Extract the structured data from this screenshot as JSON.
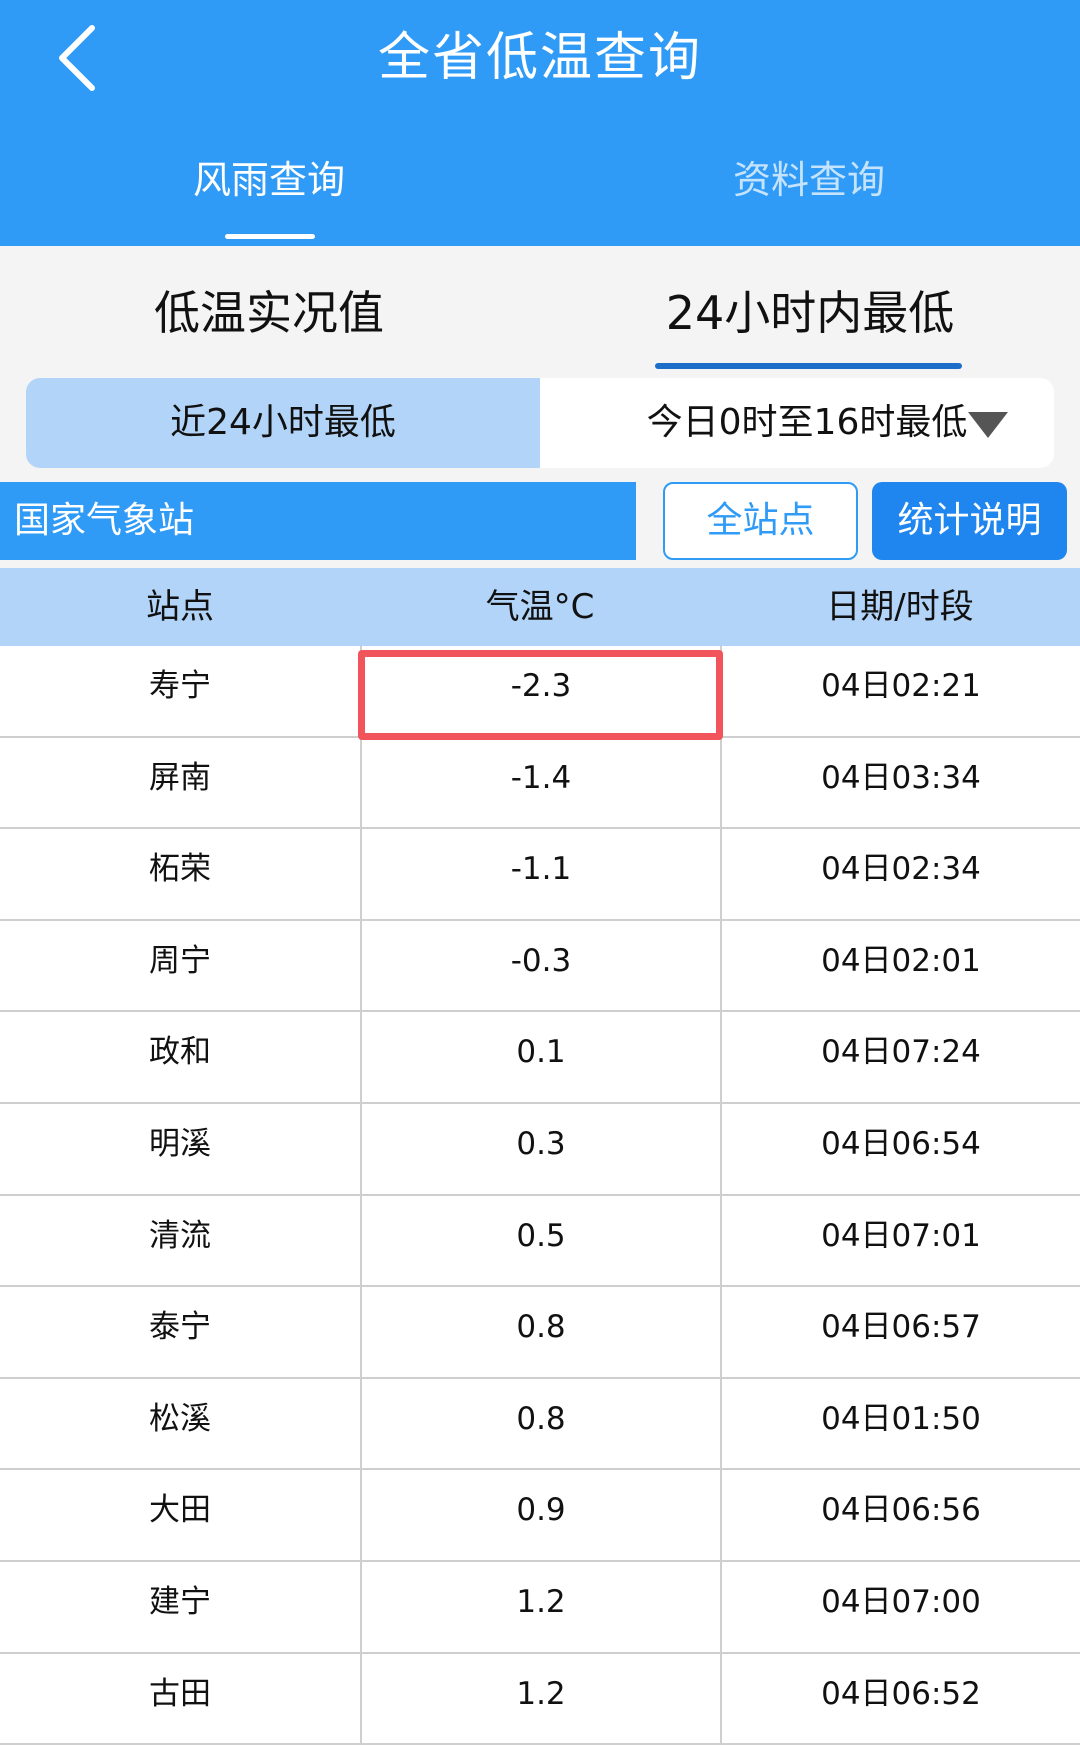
{
  "header": {
    "title": "全省低温查询",
    "tabs": [
      {
        "label": "风雨查询"
      },
      {
        "label": "资料查询"
      }
    ]
  },
  "subtabs": [
    {
      "label": "低温实况值"
    },
    {
      "label": "24小时内最低"
    }
  ],
  "segment": {
    "left_label": "近24小时最低",
    "right_label": "今日0时至16时最低"
  },
  "station_bar": {
    "label": "国家气象站",
    "all_button": "全站点",
    "stat_button": "统计说明"
  },
  "table": {
    "columns": [
      "站点",
      "气温°C",
      "日期/时段"
    ],
    "rows": [
      [
        "寿宁",
        "-2.3",
        "04日02:21"
      ],
      [
        "屏南",
        "-1.4",
        "04日03:34"
      ],
      [
        "柘荣",
        "-1.1",
        "04日02:34"
      ],
      [
        "周宁",
        "-0.3",
        "04日02:01"
      ],
      [
        "政和",
        "0.1",
        "04日07:24"
      ],
      [
        "明溪",
        "0.3",
        "04日06:54"
      ],
      [
        "清流",
        "0.5",
        "04日07:01"
      ],
      [
        "泰宁",
        "0.8",
        "04日06:57"
      ],
      [
        "松溪",
        "0.8",
        "04日01:50"
      ],
      [
        "大田",
        "0.9",
        "04日06:56"
      ],
      [
        "建宁",
        "1.2",
        "04日07:00"
      ],
      [
        "古田",
        "1.2",
        "04日06:52"
      ]
    ]
  },
  "colors": {
    "primary": "#2f9bf6",
    "light_blue": "#b2d4f8",
    "highlight": "#f2545b"
  }
}
